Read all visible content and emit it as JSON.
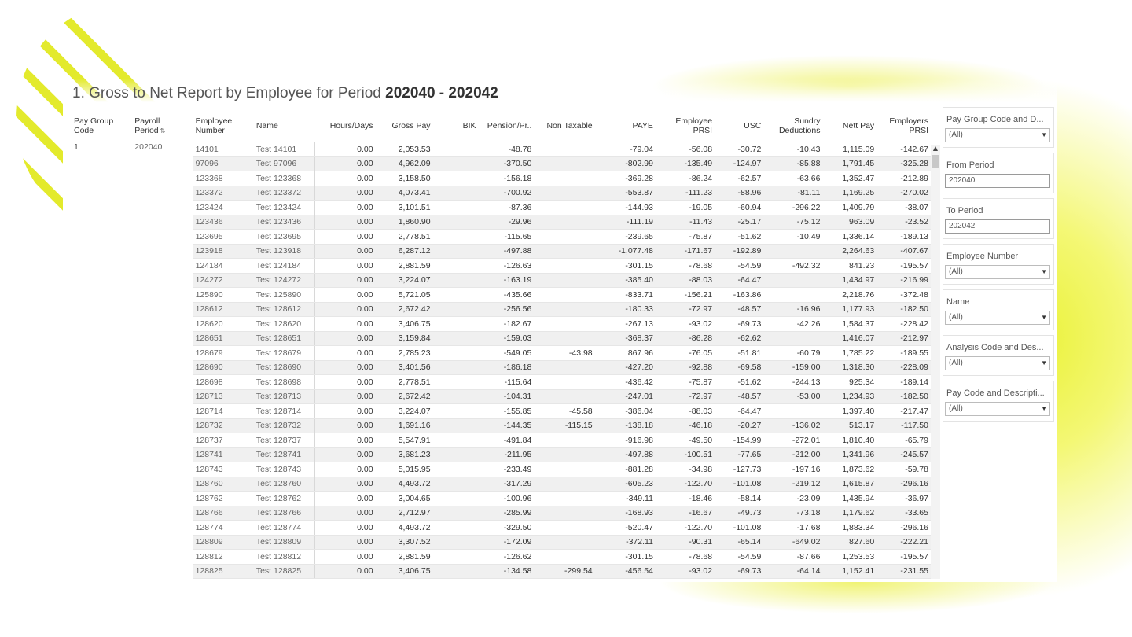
{
  "title": {
    "prefix": "1. Gross to Net Report by Employee for Period ",
    "period": "202040 - 202042"
  },
  "table": {
    "columns": [
      "Pay Group Code",
      "Payroll Period",
      "Employee Number",
      "Name",
      "Hours/Days",
      "Gross Pay",
      "BIK",
      "Pension/Pr..",
      "Non Taxable",
      "PAYE",
      "Employee PRSI",
      "USC",
      "Sundry Deductions",
      "Nett Pay",
      "Employers PRSI"
    ],
    "group": {
      "pay_group_code": "1",
      "payroll_period": "202040"
    },
    "rows": [
      [
        "14101",
        "Test 14101",
        "0.00",
        "2,053.53",
        "",
        "-48.78",
        "",
        "-79.04",
        "-56.08",
        "-30.72",
        "-10.43",
        "1,115.09",
        "-142.67"
      ],
      [
        "97096",
        "Test 97096",
        "0.00",
        "4,962.09",
        "",
        "-370.50",
        "",
        "-802.99",
        "-135.49",
        "-124.97",
        "-85.88",
        "1,791.45",
        "-325.28"
      ],
      [
        "123368",
        "Test 123368",
        "0.00",
        "3,158.50",
        "",
        "-156.18",
        "",
        "-369.28",
        "-86.24",
        "-62.57",
        "-63.66",
        "1,352.47",
        "-212.89"
      ],
      [
        "123372",
        "Test 123372",
        "0.00",
        "4,073.41",
        "",
        "-700.92",
        "",
        "-553.87",
        "-111.23",
        "-88.96",
        "-81.11",
        "1,169.25",
        "-270.02"
      ],
      [
        "123424",
        "Test 123424",
        "0.00",
        "3,101.51",
        "",
        "-87.36",
        "",
        "-144.93",
        "-19.05",
        "-60.94",
        "-296.22",
        "1,409.79",
        "-38.07"
      ],
      [
        "123436",
        "Test 123436",
        "0.00",
        "1,860.90",
        "",
        "-29.96",
        "",
        "-111.19",
        "-11.43",
        "-25.17",
        "-75.12",
        "963.09",
        "-23.52"
      ],
      [
        "123695",
        "Test 123695",
        "0.00",
        "2,778.51",
        "",
        "-115.65",
        "",
        "-239.65",
        "-75.87",
        "-51.62",
        "-10.49",
        "1,336.14",
        "-189.13"
      ],
      [
        "123918",
        "Test 123918",
        "0.00",
        "6,287.12",
        "",
        "-497.88",
        "",
        "-1,077.48",
        "-171.67",
        "-192.89",
        "",
        "2,264.63",
        "-407.67"
      ],
      [
        "124184",
        "Test 124184",
        "0.00",
        "2,881.59",
        "",
        "-126.63",
        "",
        "-301.15",
        "-78.68",
        "-54.59",
        "-492.32",
        "841.23",
        "-195.57"
      ],
      [
        "124272",
        "Test 124272",
        "0.00",
        "3,224.07",
        "",
        "-163.19",
        "",
        "-385.40",
        "-88.03",
        "-64.47",
        "",
        "1,434.97",
        "-216.99"
      ],
      [
        "125890",
        "Test 125890",
        "0.00",
        "5,721.05",
        "",
        "-435.66",
        "",
        "-833.71",
        "-156.21",
        "-163.86",
        "",
        "2,218.76",
        "-372.48"
      ],
      [
        "128612",
        "Test 128612",
        "0.00",
        "2,672.42",
        "",
        "-256.56",
        "",
        "-180.33",
        "-72.97",
        "-48.57",
        "-16.96",
        "1,177.93",
        "-182.50"
      ],
      [
        "128620",
        "Test 128620",
        "0.00",
        "3,406.75",
        "",
        "-182.67",
        "",
        "-267.13",
        "-93.02",
        "-69.73",
        "-42.26",
        "1,584.37",
        "-228.42"
      ],
      [
        "128651",
        "Test 128651",
        "0.00",
        "3,159.84",
        "",
        "-159.03",
        "",
        "-368.37",
        "-86.28",
        "-62.62",
        "",
        "1,416.07",
        "-212.97"
      ],
      [
        "128679",
        "Test 128679",
        "0.00",
        "2,785.23",
        "",
        "-549.05",
        "-43.98",
        "867.96",
        "-76.05",
        "-51.81",
        "-60.79",
        "1,785.22",
        "-189.55"
      ],
      [
        "128690",
        "Test 128690",
        "0.00",
        "3,401.56",
        "",
        "-186.18",
        "",
        "-427.20",
        "-92.88",
        "-69.58",
        "-159.00",
        "1,318.30",
        "-228.09"
      ],
      [
        "128698",
        "Test 128698",
        "0.00",
        "2,778.51",
        "",
        "-115.64",
        "",
        "-436.42",
        "-75.87",
        "-51.62",
        "-244.13",
        "925.34",
        "-189.14"
      ],
      [
        "128713",
        "Test 128713",
        "0.00",
        "2,672.42",
        "",
        "-104.31",
        "",
        "-247.01",
        "-72.97",
        "-48.57",
        "-53.00",
        "1,234.93",
        "-182.50"
      ],
      [
        "128714",
        "Test 128714",
        "0.00",
        "3,224.07",
        "",
        "-155.85",
        "-45.58",
        "-386.04",
        "-88.03",
        "-64.47",
        "",
        "1,397.40",
        "-217.47"
      ],
      [
        "128732",
        "Test 128732",
        "0.00",
        "1,691.16",
        "",
        "-144.35",
        "-115.15",
        "-138.18",
        "-46.18",
        "-20.27",
        "-136.02",
        "513.17",
        "-117.50"
      ],
      [
        "128737",
        "Test 128737",
        "0.00",
        "5,547.91",
        "",
        "-491.84",
        "",
        "-916.98",
        "-49.50",
        "-154.99",
        "-272.01",
        "1,810.40",
        "-65.79"
      ],
      [
        "128741",
        "Test 128741",
        "0.00",
        "3,681.23",
        "",
        "-211.95",
        "",
        "-497.88",
        "-100.51",
        "-77.65",
        "-212.00",
        "1,341.96",
        "-245.57"
      ],
      [
        "128743",
        "Test 128743",
        "0.00",
        "5,015.95",
        "",
        "-233.49",
        "",
        "-881.28",
        "-34.98",
        "-127.73",
        "-197.16",
        "1,873.62",
        "-59.78"
      ],
      [
        "128760",
        "Test 128760",
        "0.00",
        "4,493.72",
        "",
        "-317.29",
        "",
        "-605.23",
        "-122.70",
        "-101.08",
        "-219.12",
        "1,615.87",
        "-296.16"
      ],
      [
        "128762",
        "Test 128762",
        "0.00",
        "3,004.65",
        "",
        "-100.96",
        "",
        "-349.11",
        "-18.46",
        "-58.14",
        "-23.09",
        "1,435.94",
        "-36.97"
      ],
      [
        "128766",
        "Test 128766",
        "0.00",
        "2,712.97",
        "",
        "-285.99",
        "",
        "-168.93",
        "-16.67",
        "-49.73",
        "-73.18",
        "1,179.62",
        "-33.65"
      ],
      [
        "128774",
        "Test 128774",
        "0.00",
        "4,493.72",
        "",
        "-329.50",
        "",
        "-520.47",
        "-122.70",
        "-101.08",
        "-17.68",
        "1,883.34",
        "-296.16"
      ],
      [
        "128809",
        "Test 128809",
        "0.00",
        "3,307.52",
        "",
        "-172.09",
        "",
        "-372.11",
        "-90.31",
        "-65.14",
        "-649.02",
        "827.60",
        "-222.21"
      ],
      [
        "128812",
        "Test 128812",
        "0.00",
        "2,881.59",
        "",
        "-126.62",
        "",
        "-301.15",
        "-78.68",
        "-54.59",
        "-87.66",
        "1,253.53",
        "-195.57"
      ],
      [
        "128825",
        "Test 128825",
        "0.00",
        "3,406.75",
        "",
        "-134.58",
        "-299.54",
        "-456.54",
        "-93.02",
        "-69.73",
        "-64.14",
        "1,152.41",
        "-231.55"
      ]
    ]
  },
  "filters": [
    {
      "label": "Pay Group Code and D...",
      "type": "select",
      "value": "(All)"
    },
    {
      "label": "From Period",
      "type": "text",
      "value": "202040"
    },
    {
      "label": "To Period",
      "type": "text",
      "value": "202042"
    },
    {
      "label": "Employee Number",
      "type": "select",
      "value": "(All)"
    },
    {
      "label": "Name",
      "type": "select",
      "value": "(All)"
    },
    {
      "label": "Analysis Code and Des...",
      "type": "select",
      "value": "(All)"
    },
    {
      "label": "Pay Code and Descripti...",
      "type": "select",
      "value": "(All)"
    }
  ],
  "colors": {
    "accent_yellow": "#e8ef2a",
    "stripe_yellow": "#dfe62a",
    "row_alt": "#f0f0f0"
  },
  "icons": {
    "sort": "sort-ascending-icon",
    "dropdown": "chevron-down-icon",
    "scroll_up": "scroll-up-arrow-icon"
  }
}
